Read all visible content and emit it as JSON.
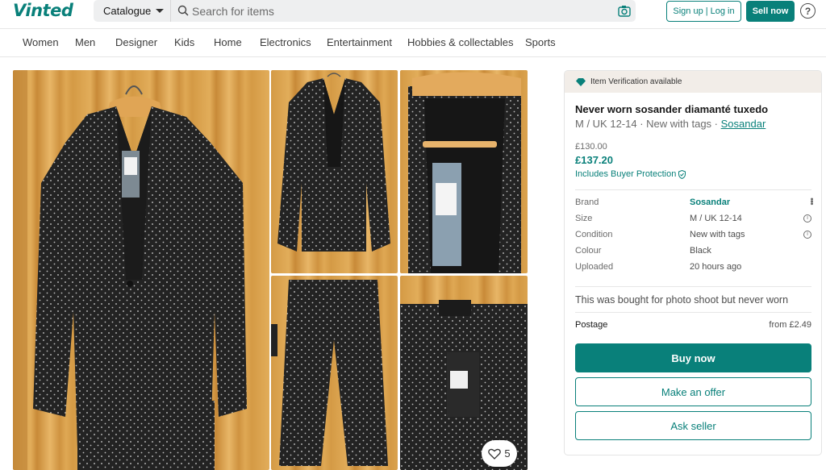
{
  "brand": {
    "logo_text": "Vinted",
    "accent": "#09807a"
  },
  "header": {
    "catalogue_label": "Catalogue",
    "search_placeholder": "Search for items",
    "signup_label": "Sign up | Log in",
    "sell_label": "Sell now",
    "help_label": "?"
  },
  "categories": [
    "Women",
    "Men",
    "Designer",
    "Kids",
    "Home",
    "Electronics",
    "Entertainment",
    "Hobbies & collectables",
    "Sports"
  ],
  "gallery": {
    "favourite_count": "5"
  },
  "item": {
    "verification": "Item Verification available",
    "title": "Never worn sosander diamanté tuxedo",
    "subtitle_prefix": "M / UK 12-14 · New with tags · ",
    "subtitle_brand": "Sosandar",
    "price_original": "£130.00",
    "price_total": "£137.20",
    "protection": "Includes Buyer Protection",
    "details": [
      {
        "key": "Brand",
        "value": "Sosandar"
      },
      {
        "key": "Size",
        "value": "M / UK 12-14"
      },
      {
        "key": "Condition",
        "value": "New with tags"
      },
      {
        "key": "Colour",
        "value": "Black"
      },
      {
        "key": "Uploaded",
        "value": "20 hours ago"
      }
    ],
    "description": "This was bought for photo shoot but never worn",
    "postage_label": "Postage",
    "postage_value": "from £2.49",
    "buy_label": "Buy now",
    "offer_label": "Make an offer",
    "ask_label": "Ask seller"
  }
}
